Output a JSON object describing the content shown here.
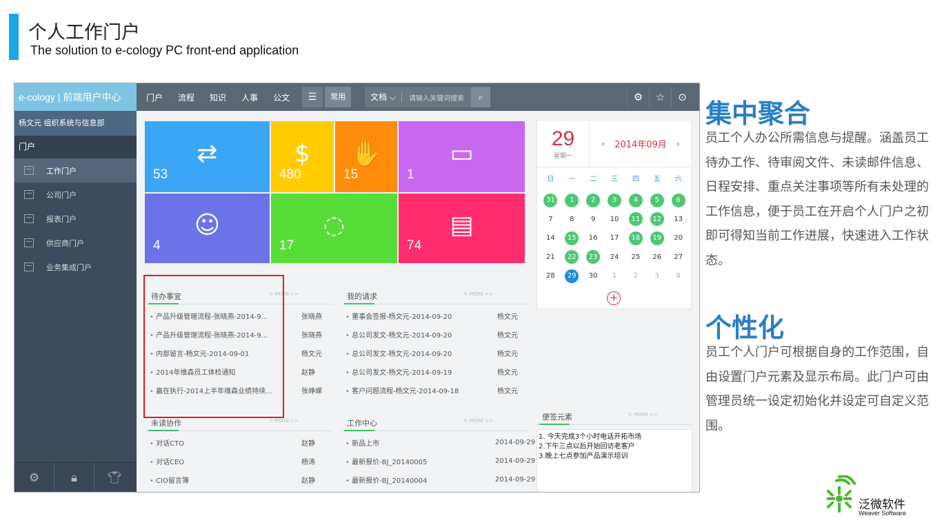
{
  "slide": {
    "title": "个人工作门户",
    "subtitle": "The solution to e-cology PC front-end application",
    "accent_color": "#1aa6e8"
  },
  "sidebar": {
    "brand": "e-cology | 前端用户中心",
    "user": "杨文元  组织系统与信息部",
    "section": "门户",
    "items": [
      {
        "label": "工作门户",
        "icon": "portal-icon"
      },
      {
        "label": "公司门户",
        "icon": "company-icon"
      },
      {
        "label": "报表门户",
        "icon": "report-icon"
      },
      {
        "label": "供应商门户",
        "icon": "supplier-icon"
      },
      {
        "label": "业务集成门户",
        "icon": "integration-icon"
      }
    ],
    "footer_icons": [
      "gear-icon",
      "lock-icon",
      "shirt-icon"
    ]
  },
  "topbar": {
    "nav": [
      "门户",
      "流程",
      "知识",
      "人事",
      "公文"
    ],
    "menu_icon": "☰",
    "common_label": "常用",
    "search_scope": "文档",
    "search_placeholder": "请输入关键词搜索",
    "right_icons": [
      "settings-icon",
      "star-icon",
      "more-icon"
    ]
  },
  "tiles": [
    {
      "count": "53",
      "color": "#3aa6f5",
      "icon": "sync-icon",
      "glyph": "⇄"
    },
    {
      "count": "480",
      "color": "#ffcc00",
      "icon": "coin-icon",
      "glyph": "$"
    },
    {
      "count": "15",
      "color": "#ff8c0a",
      "icon": "hand-icon",
      "glyph": "✋"
    },
    {
      "count": "1",
      "color": "#c868f0",
      "icon": "folder-icon",
      "glyph": "▭"
    },
    {
      "count": "4",
      "color": "#6b73e8",
      "icon": "user-icon",
      "glyph": "☺"
    },
    {
      "count": "17",
      "color": "#58dc38",
      "icon": "weibo-icon",
      "glyph": "◌"
    },
    {
      "count": "74",
      "color": "#ff2d6e",
      "icon": "document-icon",
      "glyph": "▤"
    }
  ],
  "panels": {
    "todo": {
      "title": "待办事宜",
      "more": "MORE >>",
      "rows": [
        {
          "text": "产品升级管理流程-张晓燕-2014-9...",
          "who": "张晓燕"
        },
        {
          "text": "产品升级管理流程-张晓燕-2014-9...",
          "who": "张晓燕"
        },
        {
          "text": "内部留言-杨文元-2014-09-01",
          "who": "杨文元"
        },
        {
          "text": "2014年维森员工体检通知",
          "who": "赵静"
        },
        {
          "text": "赢在执行-2014上半年维森业绩持续...",
          "who": "张峥嵘"
        }
      ]
    },
    "requests": {
      "title": "我的请求",
      "more": "MORE >>",
      "rows": [
        {
          "text": "董事会签报-杨文元-2014-09-20",
          "who": "杨文元"
        },
        {
          "text": "总公司发文-杨文元-2014-09-20",
          "who": "杨文元"
        },
        {
          "text": "总公司发文-杨文元-2014-09-20",
          "who": "杨文元"
        },
        {
          "text": "总公司发文-杨文元-2014-09-19",
          "who": "杨文元"
        },
        {
          "text": "客户问题流程-杨文元-2014-09-18",
          "who": "杨文元"
        }
      ]
    },
    "unread": {
      "title": "未读协作",
      "more": "MORE >>",
      "rows": [
        {
          "text": "对话CTO",
          "who": "赵静"
        },
        {
          "text": "对话CEO",
          "who": "杨涛"
        },
        {
          "text": "CIO留言簿",
          "who": "赵静"
        }
      ]
    },
    "work": {
      "title": "工作中心",
      "more": "MORE >>",
      "rows": [
        {
          "text": "新品上市",
          "who": "2014-09-29"
        },
        {
          "text": "最新报价-BJ_20140005",
          "who": "2014-09-29"
        },
        {
          "text": "最新报价-BJ_20140004",
          "who": "2014-09-29"
        }
      ]
    },
    "notes": {
      "title": "便签元素",
      "more": "MORE >>",
      "lines": [
        "1. 今天完成3个小时电话开拓市场",
        "2.下午三点以后开始回访老客户",
        "3.晚上七点参加产品演示培训"
      ]
    }
  },
  "calendar": {
    "day": "29",
    "weekday": "星期一",
    "month": "2014年09月",
    "prev": "‹",
    "next": "›",
    "weekdays": [
      "日",
      "一",
      "二",
      "三",
      "四",
      "五",
      "六"
    ],
    "weeks": [
      [
        {
          "d": "31",
          "s": "g"
        },
        {
          "d": "1",
          "s": "g"
        },
        {
          "d": "2",
          "s": "g"
        },
        {
          "d": "3",
          "s": "g"
        },
        {
          "d": "4",
          "s": "g"
        },
        {
          "d": "5",
          "s": "g"
        },
        {
          "d": "6",
          "s": "g"
        }
      ],
      [
        {
          "d": "7",
          "s": ""
        },
        {
          "d": "8",
          "s": ""
        },
        {
          "d": "9",
          "s": ""
        },
        {
          "d": "10",
          "s": ""
        },
        {
          "d": "11",
          "s": "g"
        },
        {
          "d": "12",
          "s": "g"
        },
        {
          "d": "13",
          "s": ""
        }
      ],
      [
        {
          "d": "14",
          "s": ""
        },
        {
          "d": "15",
          "s": "g"
        },
        {
          "d": "16",
          "s": ""
        },
        {
          "d": "17",
          "s": ""
        },
        {
          "d": "18",
          "s": "g"
        },
        {
          "d": "19",
          "s": "g"
        },
        {
          "d": "20",
          "s": ""
        }
      ],
      [
        {
          "d": "21",
          "s": ""
        },
        {
          "d": "22",
          "s": "g"
        },
        {
          "d": "23",
          "s": "g"
        },
        {
          "d": "24",
          "s": ""
        },
        {
          "d": "25",
          "s": ""
        },
        {
          "d": "26",
          "s": ""
        },
        {
          "d": "27",
          "s": ""
        }
      ],
      [
        {
          "d": "28",
          "s": ""
        },
        {
          "d": "29",
          "s": "b"
        },
        {
          "d": "30",
          "s": ""
        },
        {
          "d": "1",
          "s": "m"
        },
        {
          "d": "2",
          "s": "m"
        },
        {
          "d": "3",
          "s": "m"
        },
        {
          "d": "4",
          "s": "m"
        }
      ]
    ],
    "add": "+"
  },
  "right": {
    "h1": "集中聚合",
    "p1": "员工个人办公所需信息与提醒。涵盖员工待办工作、待审阅文件、未读邮件信息、日程安排、重点关注事项等所有未处理的工作信息，便于员工在开启个人门户之初即可得知当前工作进展，快速进入工作状态。",
    "h2": "个性化",
    "p2": "员工个人门户可根据自身的工作范围，自由设置门户元素及显示布局。此门户可由管理员统一设定初始化并设定可自定义范围。",
    "heading_color": "#2a7fc4"
  },
  "logo": {
    "cn": "泛微软件",
    "en": "Weaver Software",
    "color": "#4cb82e"
  }
}
